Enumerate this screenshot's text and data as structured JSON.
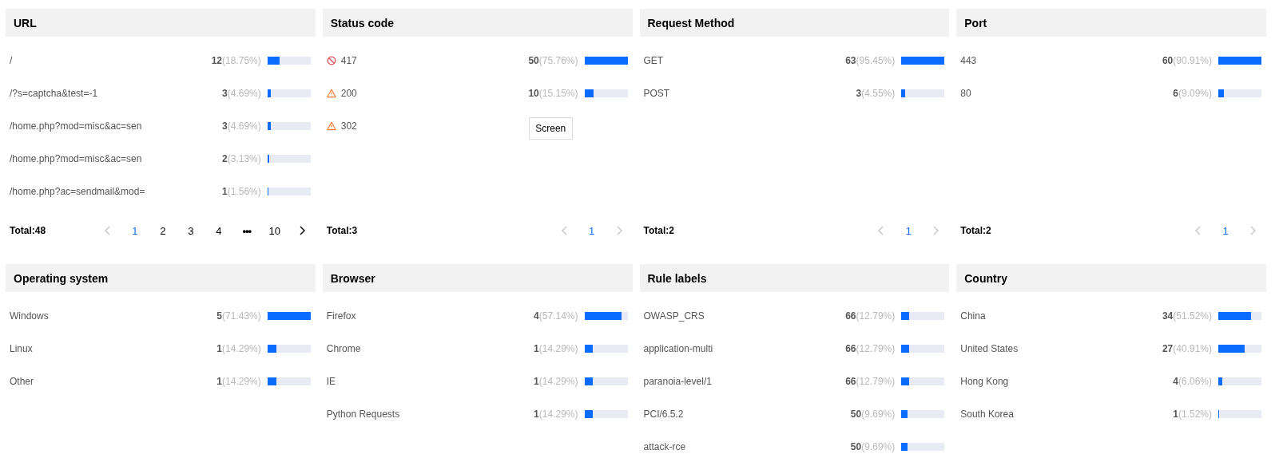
{
  "panels": [
    {
      "title": "URL",
      "items": [
        {
          "label": "/",
          "count": "12",
          "share": "(18.75%)",
          "level": 0.28
        },
        {
          "label": "/?s=captcha&test=-1",
          "count": "3",
          "share": "(4.69%)",
          "level": 0.07
        },
        {
          "label": "/home.php?mod=misc&ac=sen",
          "count": "3",
          "share": "(4.69%)",
          "level": 0.07
        },
        {
          "label": "/home.php?mod=misc&ac=sen",
          "count": "2",
          "share": "(3.13%)",
          "level": 0.05
        },
        {
          "label": "/home.php?ac=sendmail&mod=",
          "count": "1",
          "share": "(1.56%)",
          "level": 0.02
        }
      ],
      "footer": {
        "total": "Total:48",
        "prev": {
          "disabled": true
        },
        "next": {
          "disabled": false
        },
        "pages": [
          {
            "label": "1",
            "kind": "page",
            "selected": true
          },
          {
            "label": "2",
            "kind": "page",
            "selected": false
          },
          {
            "label": "3",
            "kind": "page",
            "selected": false
          },
          {
            "label": "4",
            "kind": "page",
            "selected": false
          },
          {
            "label": "•••",
            "kind": "ellipsis"
          },
          {
            "label": "10",
            "kind": "page",
            "selected": false
          }
        ]
      }
    },
    {
      "title": "Status code",
      "items": [
        {
          "kind": "blocked",
          "label": "417",
          "count": "50",
          "share": "(75.76%)",
          "level": 1
        },
        {
          "kind": "warning",
          "label": "200",
          "count": "10",
          "share": "(15.15%)",
          "level": 0.22
        },
        {
          "kind": "warning",
          "label": "302"
        }
      ],
      "screen_button": {
        "label": "Screen"
      },
      "footer": {
        "total": "Total:3",
        "prev": {
          "disabled": true
        },
        "next": {
          "disabled": true
        },
        "pages": [
          {
            "label": "1",
            "kind": "page",
            "selected": true
          }
        ]
      }
    },
    {
      "title": "Request Method",
      "items": [
        {
          "label": "GET",
          "count": "63",
          "share": "(95.45%)",
          "level": 1
        },
        {
          "label": "POST",
          "count": "3",
          "share": "(4.55%)",
          "level": 0.08
        }
      ],
      "footer": {
        "total": "Total:2",
        "prev": {
          "disabled": true
        },
        "next": {
          "disabled": true
        },
        "pages": [
          {
            "label": "1",
            "kind": "page",
            "selected": true
          }
        ]
      }
    },
    {
      "title": "Port",
      "items": [
        {
          "label": "443",
          "count": "60",
          "share": "(90.91%)",
          "level": 1
        },
        {
          "label": "80",
          "count": "6",
          "share": "(9.09%)",
          "level": 0.13
        }
      ],
      "footer": {
        "total": "Total:2",
        "prev": {
          "disabled": true
        },
        "next": {
          "disabled": true
        },
        "pages": [
          {
            "label": "1",
            "kind": "page",
            "selected": true
          }
        ]
      }
    },
    {
      "title": "Operating system",
      "items": [
        {
          "label": "Windows",
          "count": "5",
          "share": "(71.43%)",
          "level": 1
        },
        {
          "label": "Linux",
          "count": "1",
          "share": "(14.29%)",
          "level": 0.2
        },
        {
          "label": "Other",
          "count": "1",
          "share": "(14.29%)",
          "level": 0.2
        }
      ]
    },
    {
      "title": "Browser",
      "items": [
        {
          "label": "Firefox",
          "count": "4",
          "share": "(57.14%)",
          "level": 0.86
        },
        {
          "label": "Chrome",
          "count": "1",
          "share": "(14.29%)",
          "level": 0.2
        },
        {
          "label": "IE",
          "count": "1",
          "share": "(14.29%)",
          "level": 0.2
        },
        {
          "label": "Python Requests",
          "count": "1",
          "share": "(14.29%)",
          "level": 0.2
        }
      ]
    },
    {
      "title": "Rule labels",
      "items": [
        {
          "label": "OWASP_CRS",
          "count": "66",
          "share": "(12.79%)",
          "level": 0.18
        },
        {
          "label": "application-multi",
          "count": "66",
          "share": "(12.79%)",
          "level": 0.18
        },
        {
          "label": "paranoia-level/1",
          "count": "66",
          "share": "(12.79%)",
          "level": 0.18
        },
        {
          "label": "PCI/6.5.2",
          "count": "50",
          "share": "(9.69%)",
          "level": 0.15
        },
        {
          "label": "attack-rce",
          "count": "50",
          "share": "(9.69%)",
          "level": 0.15
        }
      ]
    },
    {
      "title": "Country",
      "items": [
        {
          "label": "China",
          "count": "34",
          "share": "(51.52%)",
          "level": 0.76
        },
        {
          "label": "United States",
          "count": "27",
          "share": "(40.91%)",
          "level": 0.61
        },
        {
          "label": "Hong Kong",
          "count": "4",
          "share": "(6.06%)",
          "level": 0.09
        },
        {
          "label": "South Korea",
          "count": "1",
          "share": "(1.52%)",
          "level": 0.02
        }
      ]
    }
  ]
}
